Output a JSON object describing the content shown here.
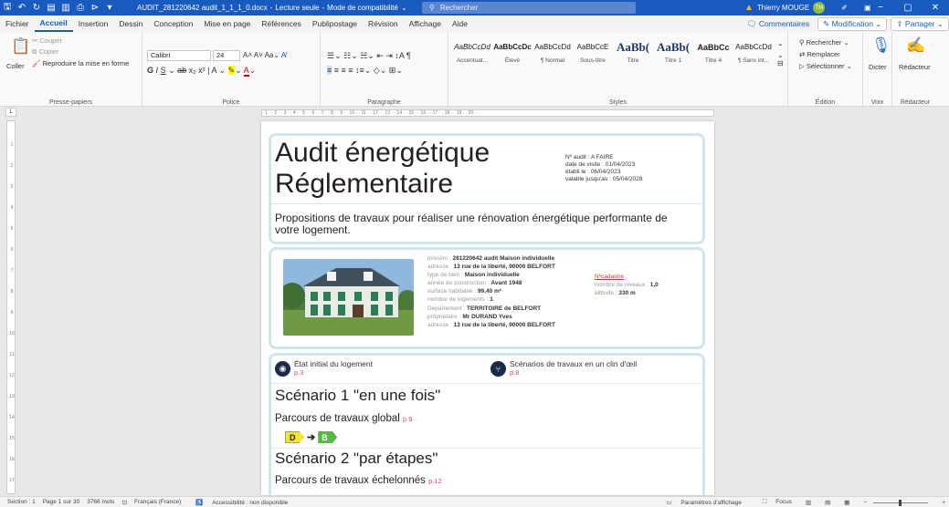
{
  "titlebar": {
    "filename": "AUDIT_281220642 audit_1_1_1_0.docx",
    "status": "Lecture seule",
    "mode": "Mode de compatibilité",
    "search_placeholder": "Rechercher",
    "user_name": "Thierry MOUGE",
    "user_initials": "TM"
  },
  "menu": {
    "tabs": [
      "Fichier",
      "Accueil",
      "Insertion",
      "Dessin",
      "Conception",
      "Mise en page",
      "Références",
      "Publipostage",
      "Révision",
      "Affichage",
      "Aide"
    ],
    "active_tab": "Accueil",
    "comments": "Commentaires",
    "modification": "Modification",
    "share": "Partager"
  },
  "ribbon": {
    "clipboard": {
      "label": "Presse-papiers",
      "paste": "Coller",
      "cut": "Couper",
      "copy": "Copier",
      "format_painter": "Reproduire la mise en forme"
    },
    "font": {
      "label": "Police",
      "name": "Calibri",
      "size": "24"
    },
    "paragraph": {
      "label": "Paragraphe"
    },
    "styles": {
      "label": "Styles",
      "items": [
        {
          "sample": "AaBbCcDd",
          "name": "Accentuat..."
        },
        {
          "sample": "AaBbCcDc",
          "name": "Élevé"
        },
        {
          "sample": "AaBbCcDd",
          "name": "¶ Normal"
        },
        {
          "sample": "AaBbCcE",
          "name": "Sous-titre"
        },
        {
          "sample": "AaBb(",
          "name": "Titre"
        },
        {
          "sample": "AaBb(",
          "name": "Titre 1"
        },
        {
          "sample": "AaBbCc",
          "name": "Titre 4"
        },
        {
          "sample": "AaBbCcDd",
          "name": "¶ Sans int..."
        }
      ]
    },
    "editing": {
      "label": "Édition",
      "find": "Rechercher",
      "replace": "Remplacer",
      "select": "Sélectionner"
    },
    "voice": {
      "label": "Voix",
      "dictate": "Dicter"
    },
    "editor": {
      "label": "Rédacteur",
      "button": "Rédacteur"
    }
  },
  "document": {
    "title": "Audit énergétique Réglementaire",
    "meta": [
      "Nº audit : A FAIRE",
      "date de visite : 01/04/2023",
      "établi le : 06/04/2023",
      "valable jusqu'au : 05/04/2028"
    ],
    "subtitle": "Propositions de travaux pour réaliser une rénovation énergétique performante de votre logement.",
    "info_left": [
      {
        "label": "mission :",
        "value": "281220642 audit Maison individuelle"
      },
      {
        "label": "adresse :",
        "value": "13  rue de la liberté, 90000 BELFORT"
      },
      {
        "label": "type de bien :",
        "value": "Maison individuelle"
      },
      {
        "label": "année de construction :",
        "value": "Avant 1948"
      },
      {
        "label": "surface habitable :",
        "value": "99,40 m²"
      },
      {
        "label": "nombre de logements :",
        "value": "1"
      },
      {
        "label": "Département :",
        "value": "TERRITOIRE de BELFORT"
      },
      {
        "label": "propriétaire :",
        "value": "Mr DURAND Yves"
      },
      {
        "label": "adresse :",
        "value": "13  rue de la liberté, 90000 BELFORT"
      }
    ],
    "info_right": {
      "cadastre_label": "Nºcadastre",
      "cadastre_suffix": " :",
      "levels_label": "nombre de niveaux :",
      "levels_value": "1,0",
      "altitude_label": "altitude :",
      "altitude_value": "330 m"
    },
    "section_initial": {
      "title": "État initial du logement",
      "page": "p.3"
    },
    "section_scenarios": {
      "title": "Scénarios de travaux en un clin d'œil",
      "page": "p.8"
    },
    "scenario1": {
      "title": "Scénario 1 \"en une fois\"",
      "subtitle": "Parcours de travaux global",
      "page": "p.9",
      "from": "D",
      "to": "B"
    },
    "scenario2": {
      "title": "Scénario 2 \"par étapes\"",
      "subtitle": "Parcours de travaux échelonnés",
      "page": "p.12"
    }
  },
  "statusbar": {
    "section": "Section : 1",
    "page": "Page 1 sur 30",
    "words": "3766 mots",
    "language": "Français (France)",
    "accessibility": "Accessibilité : non disponible",
    "display_settings": "Paramètres d'affichage",
    "focus": "Focus"
  },
  "colors": {
    "titlebar": "#185abd",
    "accent": "#185abd",
    "page_ref": "#d63a8a",
    "card_border": "#cfe6ec",
    "class_d": "#f5e62a",
    "class_b": "#57b944"
  }
}
